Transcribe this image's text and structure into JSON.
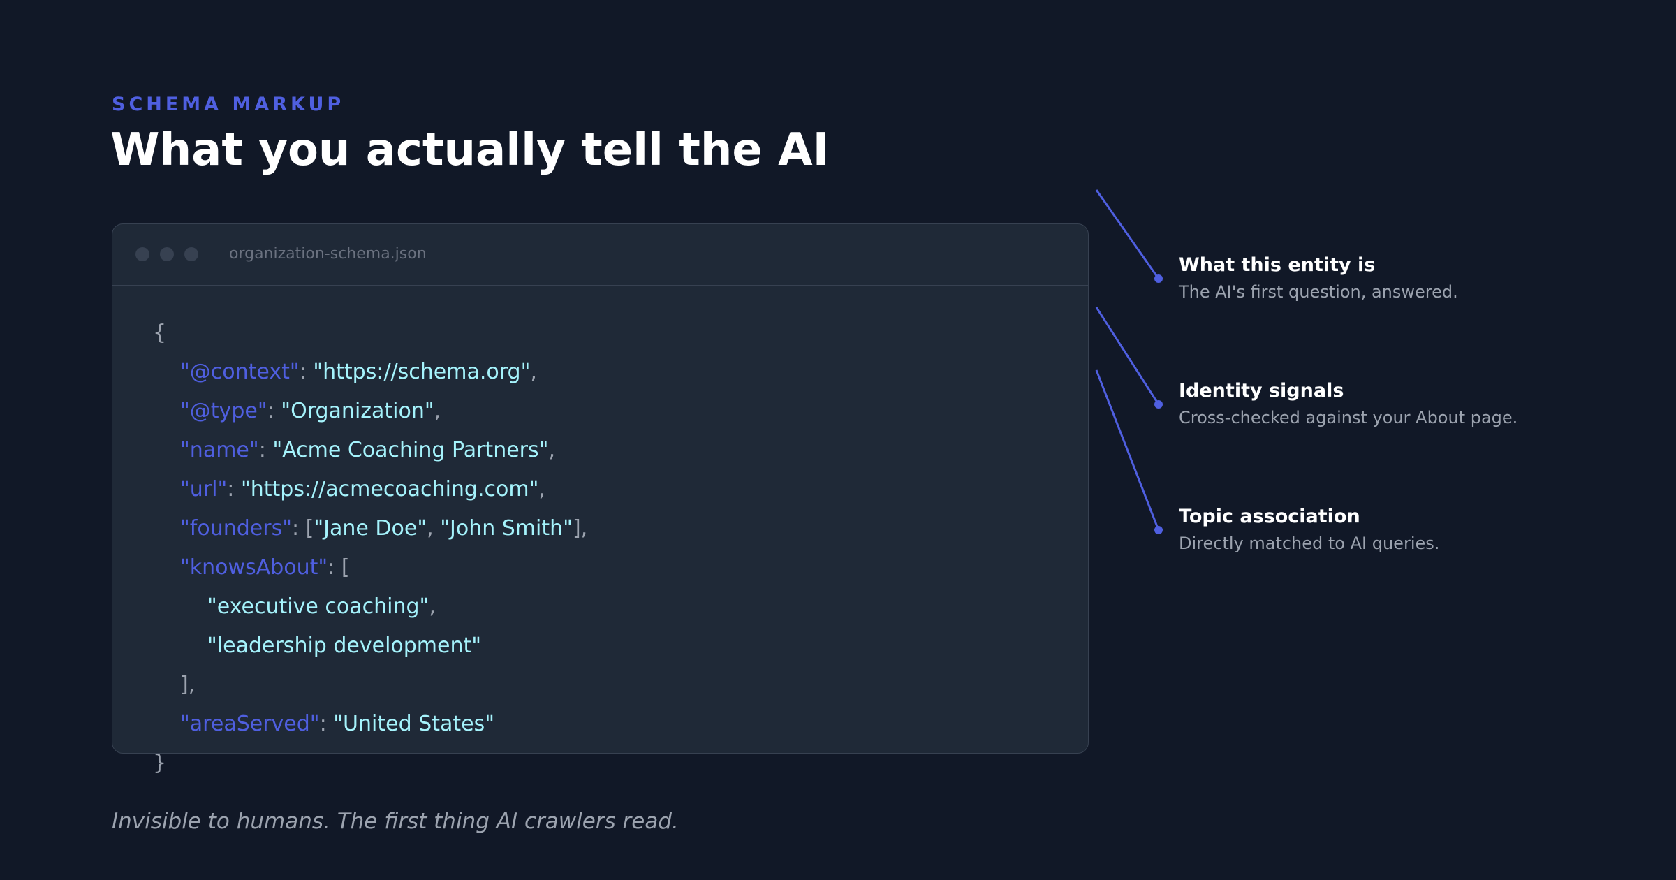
{
  "header": {
    "eyebrow": "SCHEMA MARKUP",
    "title": "What you actually tell the AI"
  },
  "code_window": {
    "filename": "organization-schema.json",
    "lines": {
      "open_brace": "{",
      "context": {
        "key": "\"@context\"",
        "sep": ": ",
        "value": "\"https://schema.org\"",
        "end": ","
      },
      "type": {
        "key": "\"@type\"",
        "sep": ": ",
        "value": "\"Organization\"",
        "end": ","
      },
      "name": {
        "key": "\"name\"",
        "sep": ": ",
        "value": "\"Acme Coaching Partners\"",
        "end": ","
      },
      "url": {
        "key": "\"url\"",
        "sep": ": ",
        "value": "\"https://acmecoaching.com\"",
        "end": ","
      },
      "founders": {
        "key": "\"founders\"",
        "sep": ": [",
        "value_1": "\"Jane Doe\"",
        "mid": ", ",
        "value_2": "\"John Smith\"",
        "end": "],"
      },
      "knows_about": {
        "key": "\"knowsAbout\"",
        "sep": ": ["
      },
      "knows_about_items": [
        {
          "value": "\"executive coaching\"",
          "end": ","
        },
        {
          "value": "\"leadership development\"",
          "end": ""
        }
      ],
      "knows_about_close": "],",
      "area_served": {
        "key": "\"areaServed\"",
        "sep": ": ",
        "value": "\"United States\""
      },
      "close_brace": "}"
    }
  },
  "annotations": [
    {
      "title": "What this entity is",
      "description": "The AI's first question, answered."
    },
    {
      "title": "Identity signals",
      "description": "Cross-checked against your About page."
    },
    {
      "title": "Topic association",
      "description": "Directly matched to AI queries."
    }
  ],
  "footer": {
    "caption": "Invisible to humans. The first thing AI crawlers read."
  },
  "colors": {
    "background": "#111827",
    "panel": "#1f2937",
    "accent": "#4f5fe0",
    "string": "#a5f3fc",
    "muted": "#9ca3af"
  }
}
